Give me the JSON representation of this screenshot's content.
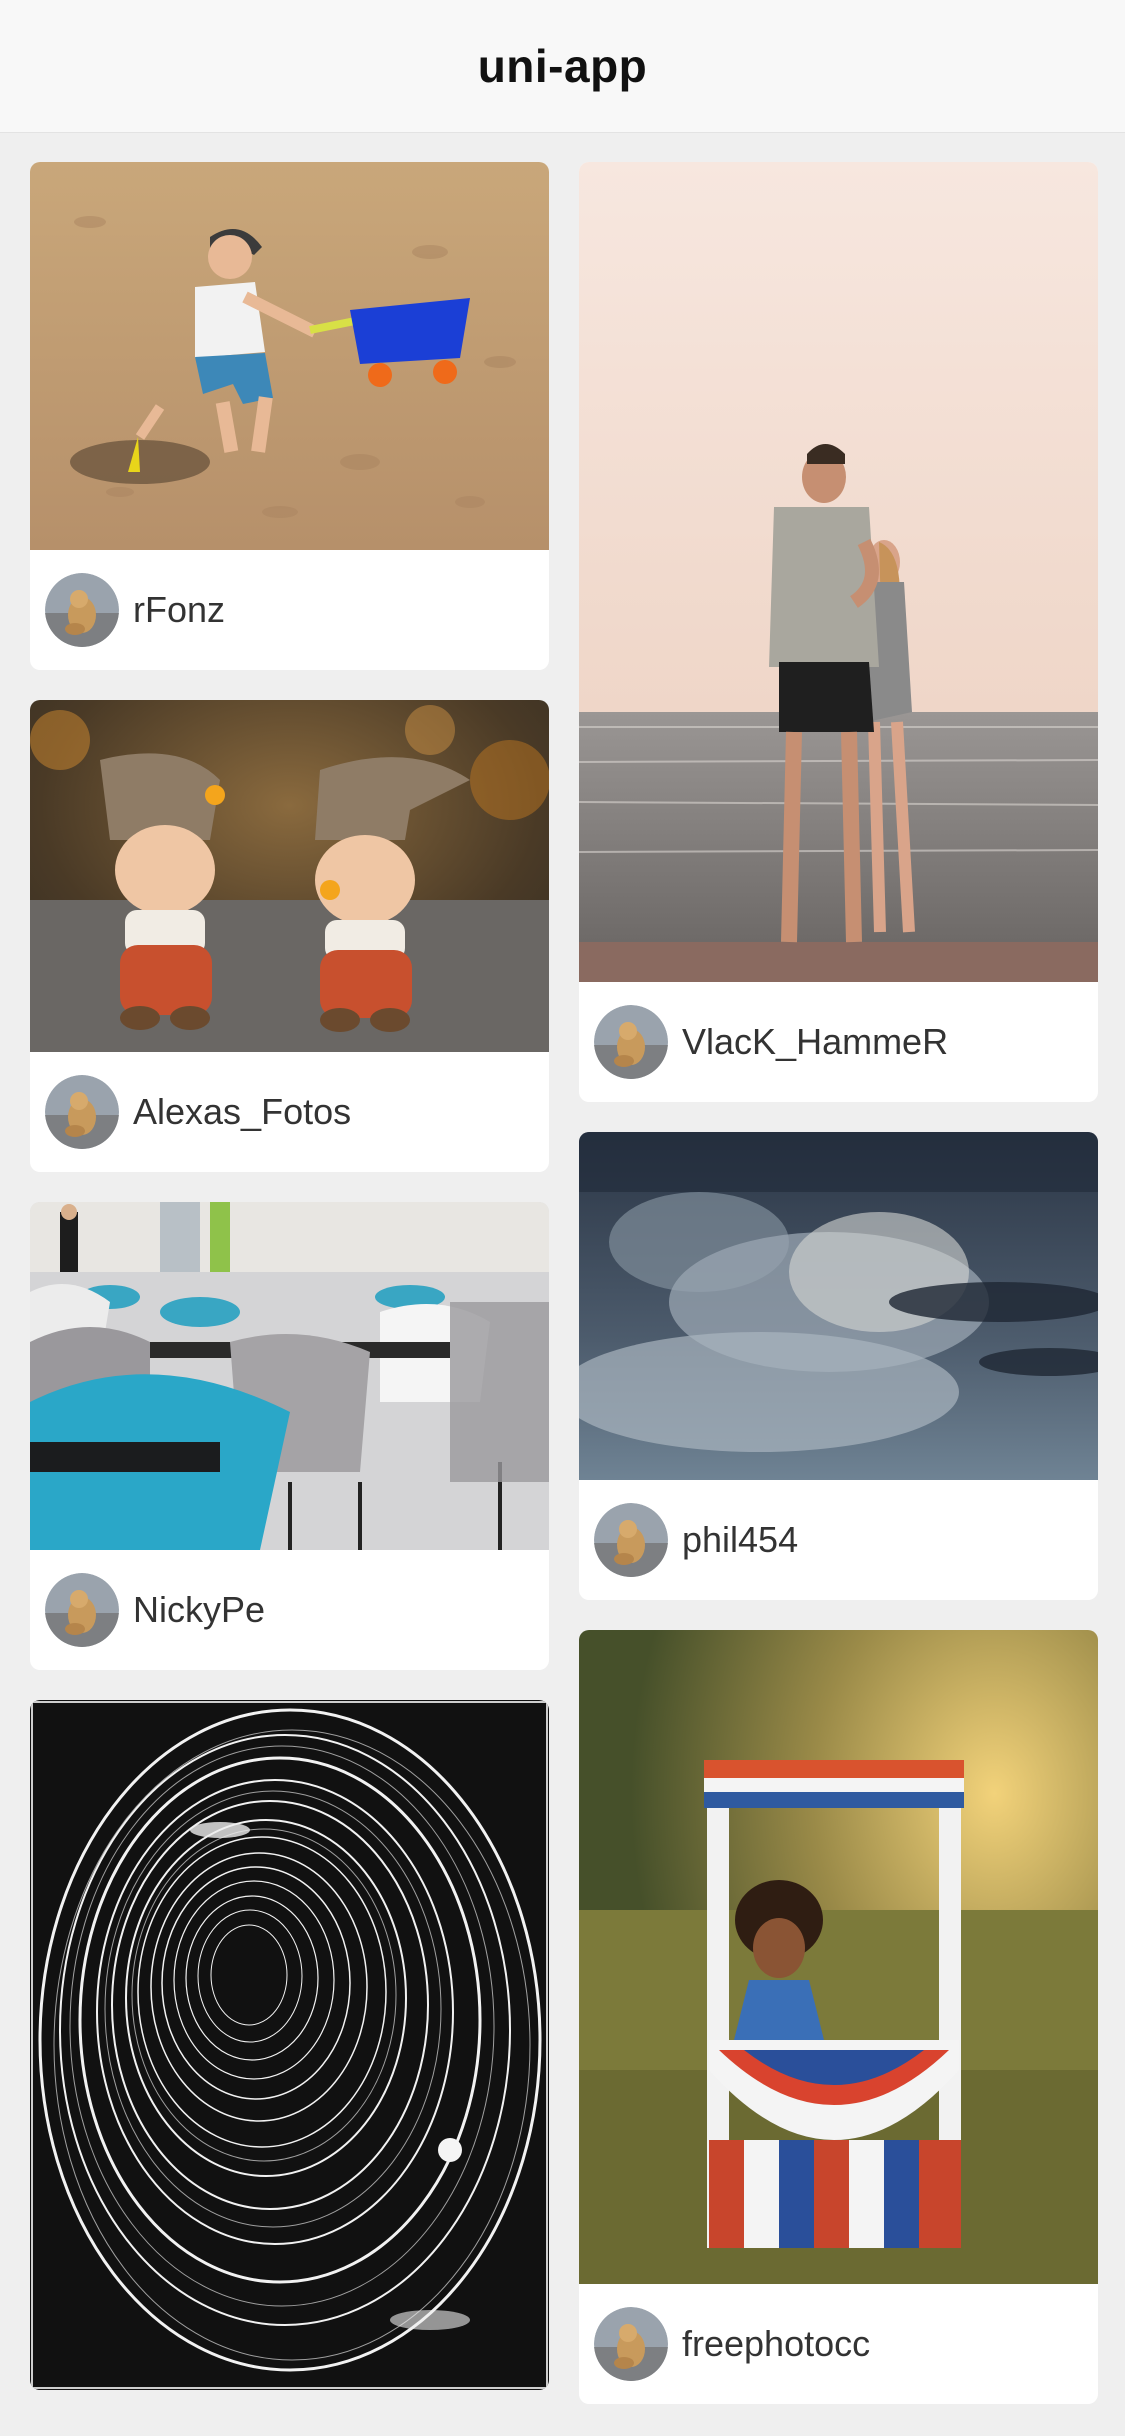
{
  "navbar": {
    "title": "uni-app"
  },
  "feed": {
    "left": [
      {
        "author": "rFonz",
        "photo": "boy-with-wagon-on-beach"
      },
      {
        "author": "Alexas_Fotos",
        "photo": "two-gnome-figurines"
      },
      {
        "author": "NickyPe",
        "photo": "cafe-chairs"
      },
      {
        "author": "",
        "photo": "black-white-vortex"
      }
    ],
    "right": [
      {
        "author": "VlacK_HammeR",
        "photo": "couple-kissing-by-sea"
      },
      {
        "author": "phil454",
        "photo": "stormy-clouds"
      },
      {
        "author": "freephotocc",
        "photo": "girl-at-lemonade-stand"
      }
    ]
  },
  "colors": {
    "navbar_bg": "#f8f8f8",
    "page_bg": "#efefef",
    "card_bg": "#ffffff"
  }
}
